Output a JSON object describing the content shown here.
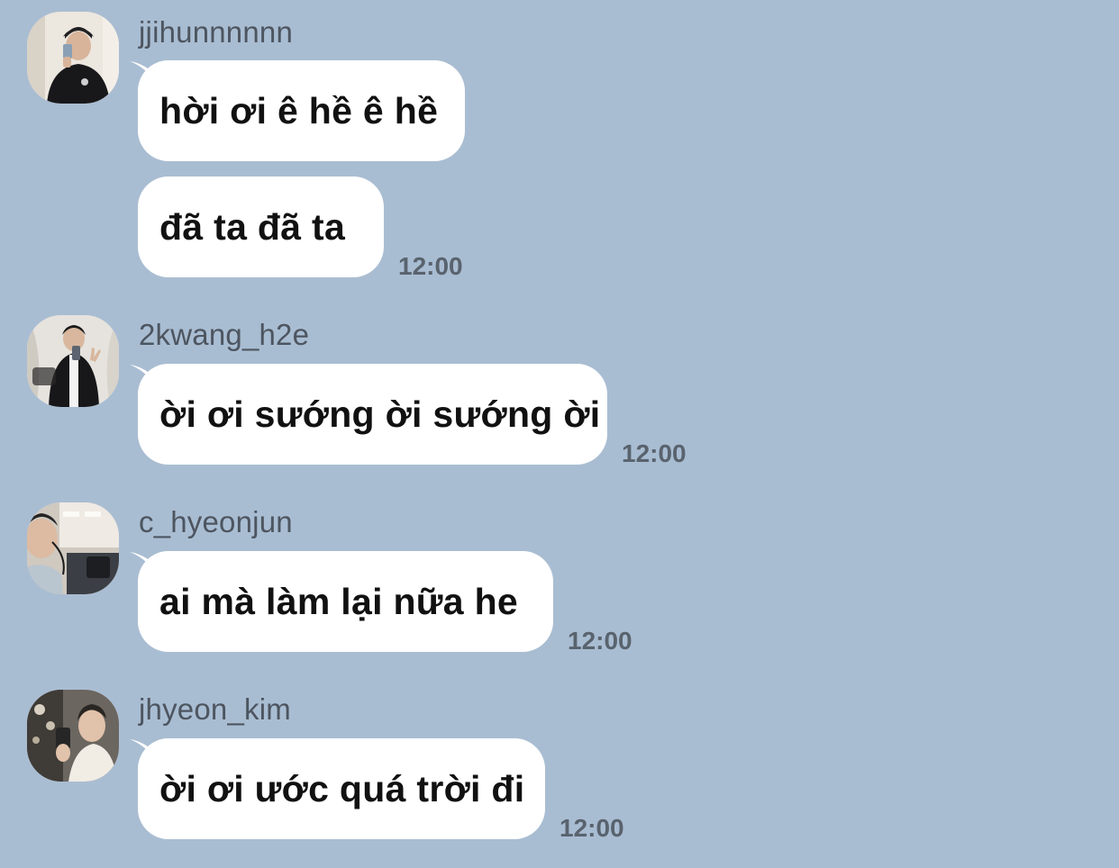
{
  "messages": [
    {
      "sender": "jjihunnnnnn",
      "bubbles": [
        "hời ơi ê hề ê hề",
        "đã ta đã ta"
      ],
      "time": "12:00"
    },
    {
      "sender": "2kwang_h2e",
      "bubbles": [
        "ời ơi sướng ời sướng ời"
      ],
      "time": "12:00"
    },
    {
      "sender": "c_hyeonjun",
      "bubbles": [
        "ai mà làm lại nữa he"
      ],
      "time": "12:00"
    },
    {
      "sender": "jhyeon_kim",
      "bubbles": [
        "ời ơi ước quá trời đi"
      ],
      "time": "12:00"
    }
  ],
  "colors": {
    "background": "#a9bdd2",
    "bubble": "#ffffff",
    "sender_text": "#4d5560",
    "time_text": "#59636e"
  },
  "icons": [
    "avatar-photo-jjihunnnnnn",
    "avatar-photo-2kwang_h2e",
    "avatar-photo-c_hyeonjun",
    "avatar-photo-jhyeon_kim"
  ]
}
